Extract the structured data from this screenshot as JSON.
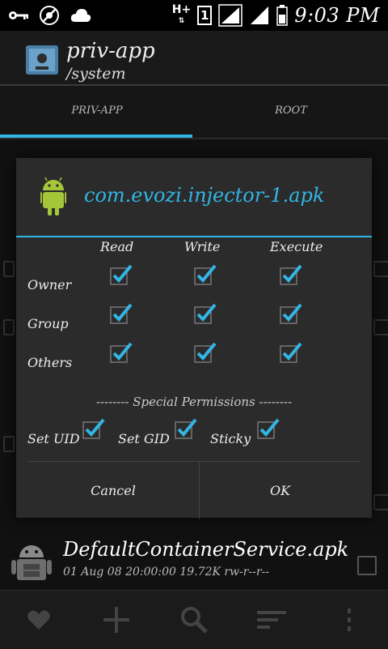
{
  "status": {
    "time": "9:03 PM",
    "network_type": "H+",
    "sim_slot": "1"
  },
  "app": {
    "title": "priv-app",
    "subtitle": "/system"
  },
  "tabs": [
    {
      "label": "PRIV-APP",
      "active": true
    },
    {
      "label": "ROOT",
      "active": false
    }
  ],
  "list": {
    "visible_item": {
      "name": "DefaultContainerService.apk",
      "meta": "01 Aug 08 20:00:00  19.72K  rw-r--r--"
    }
  },
  "dialog": {
    "title": "com.evozi.injector-1.apk",
    "columns": [
      "Read",
      "Write",
      "Execute"
    ],
    "rows": [
      {
        "label": "Owner",
        "read": true,
        "write": true,
        "execute": true
      },
      {
        "label": "Group",
        "read": true,
        "write": true,
        "execute": true
      },
      {
        "label": "Others",
        "read": true,
        "write": true,
        "execute": true
      }
    ],
    "special_header": "-------- Special Permissions --------",
    "special": [
      {
        "label": "Set UID",
        "checked": true
      },
      {
        "label": "Set GID",
        "checked": true
      },
      {
        "label": "Sticky",
        "checked": true
      }
    ],
    "cancel_label": "Cancel",
    "ok_label": "OK"
  },
  "bottom_bar": [
    {
      "icon": "heart-icon"
    },
    {
      "icon": "plus-icon"
    },
    {
      "icon": "search-icon"
    },
    {
      "icon": "sort-icon"
    },
    {
      "icon": "overflow-icon"
    }
  ],
  "colors": {
    "accent": "#33b5e5",
    "background": "#0d0d0d",
    "dialog": "#2b2b2b"
  }
}
